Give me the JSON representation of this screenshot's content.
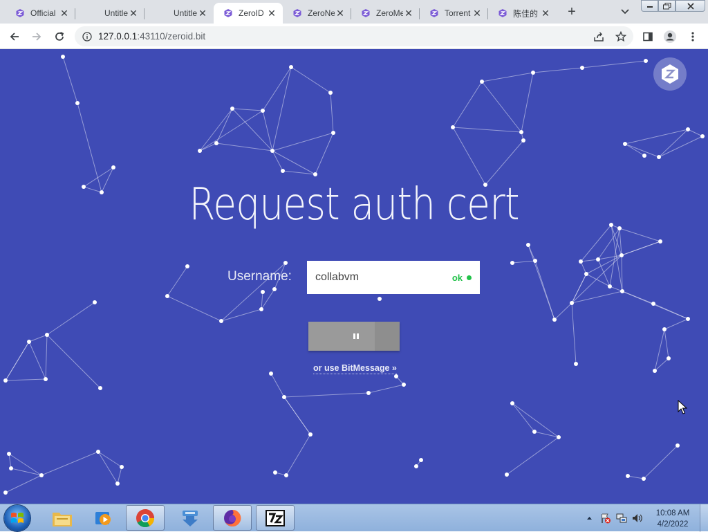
{
  "browser": {
    "tabs": [
      {
        "title": "Official",
        "icon": "zeronet-icon",
        "active": false
      },
      {
        "title": "Untitled",
        "icon": "none",
        "active": false
      },
      {
        "title": "Untitled",
        "icon": "none",
        "active": false
      },
      {
        "title": "ZeroID",
        "icon": "zeronet-icon",
        "active": true
      },
      {
        "title": "ZeroNet",
        "icon": "zeronet-icon",
        "active": false
      },
      {
        "title": "ZeroMe",
        "icon": "zeronet-icon",
        "active": false
      },
      {
        "title": "Torrent",
        "icon": "zeronet-icon",
        "active": false
      },
      {
        "title": "陈佳的",
        "icon": "zeronet-icon",
        "active": false
      }
    ],
    "url_host": "127.0.0.1",
    "url_path": ":43110/zeroid.bit"
  },
  "page": {
    "heading": "Request auth cert",
    "username_label": "Username:",
    "username_value": "collabvm",
    "username_status": "ok",
    "submit_progress": 0.73,
    "alt_link": "or use BitMessage »",
    "background_color": "#3f4bb5",
    "status_color": "#22c24a"
  },
  "taskbar": {
    "apps": [
      "file-explorer-icon",
      "media-player-icon",
      "chrome-icon",
      "downloader-icon",
      "firefox-icon",
      "7zip-icon"
    ],
    "time": "10:08 AM",
    "date": "4/2/2022"
  }
}
